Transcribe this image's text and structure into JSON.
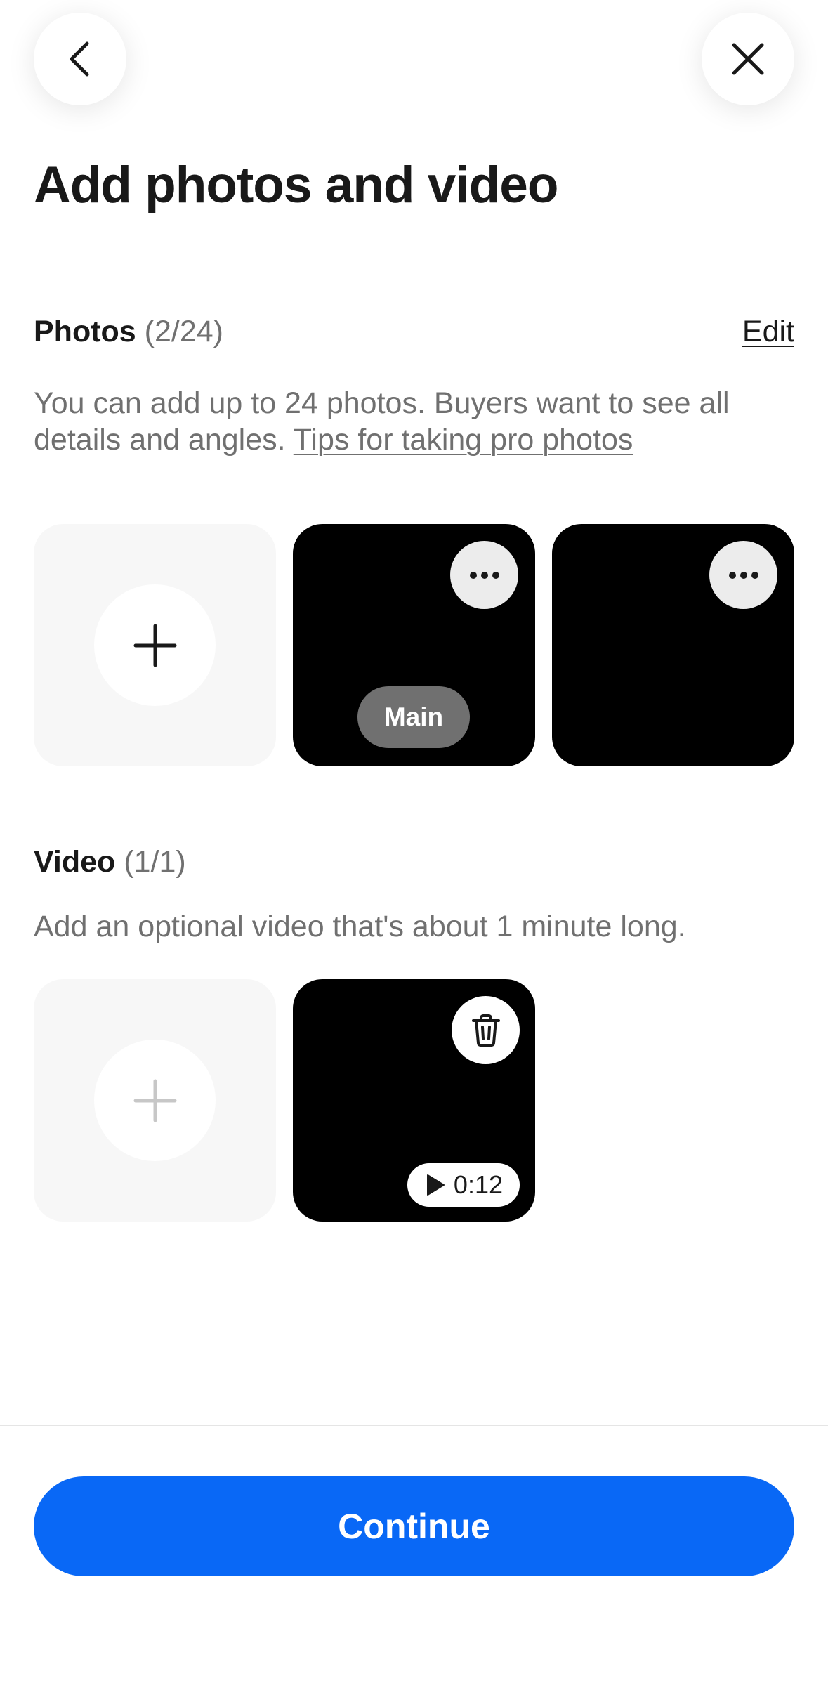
{
  "header": {
    "back_icon": "chevron-left-icon",
    "close_icon": "close-icon",
    "title": "Add photos and video"
  },
  "photos": {
    "label": "Photos",
    "count": "(2/24)",
    "edit_label": "Edit",
    "description": "You can add up to 24 photos. Buyers want to see all details and angles.",
    "tips_link": "Tips for taking pro photos",
    "add_icon": "plus-icon",
    "items": [
      {
        "badge": "Main",
        "menu_icon": "more-horizontal-icon"
      },
      {
        "menu_icon": "more-horizontal-icon"
      }
    ]
  },
  "video": {
    "label": "Video",
    "count": "(1/1)",
    "description": "Add an optional video that's about 1 minute long.",
    "add_icon": "plus-icon",
    "item": {
      "duration": "0:12",
      "delete_icon": "trash-icon",
      "play_icon": "play-icon"
    }
  },
  "footer": {
    "continue_label": "Continue",
    "accent_color": "#0968f6"
  }
}
